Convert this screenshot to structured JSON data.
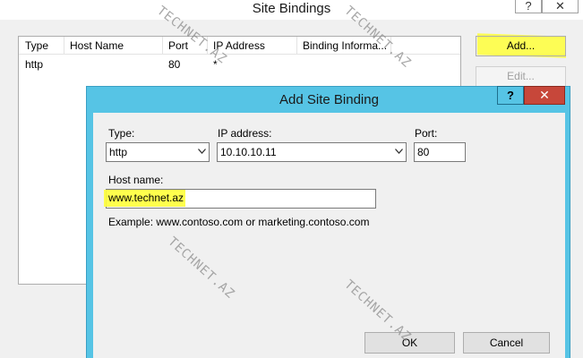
{
  "site_bindings": {
    "title": "Site Bindings",
    "help_label": "?",
    "close_label": "✕",
    "columns": [
      "Type",
      "Host Name",
      "Port",
      "IP Address",
      "Binding Informa..."
    ],
    "rows": [
      {
        "type": "http",
        "host_name": "",
        "port": "80",
        "ip_address": "*",
        "binding_info": ""
      }
    ],
    "add_button": "Add...",
    "edit_button": "Edit..."
  },
  "add_site_binding": {
    "title": "Add Site Binding",
    "help_label": "?",
    "close_label": "✕",
    "type_label": "Type:",
    "type_value": "http",
    "ip_label": "IP address:",
    "ip_value": "10.10.10.11",
    "port_label": "Port:",
    "port_value": "80",
    "host_label": "Host name:",
    "host_value": "www.technet.az",
    "example_text": "Example: www.contoso.com or marketing.contoso.com",
    "ok_button": "OK",
    "cancel_button": "Cancel"
  },
  "watermark": "TECHNET.AZ",
  "colors": {
    "dialog_frame": "#56c4e5",
    "close_button": "#c7473a",
    "highlight": "#ffff3a"
  },
  "icons": [
    "chevron-down-icon",
    "close-icon",
    "help-icon"
  ]
}
